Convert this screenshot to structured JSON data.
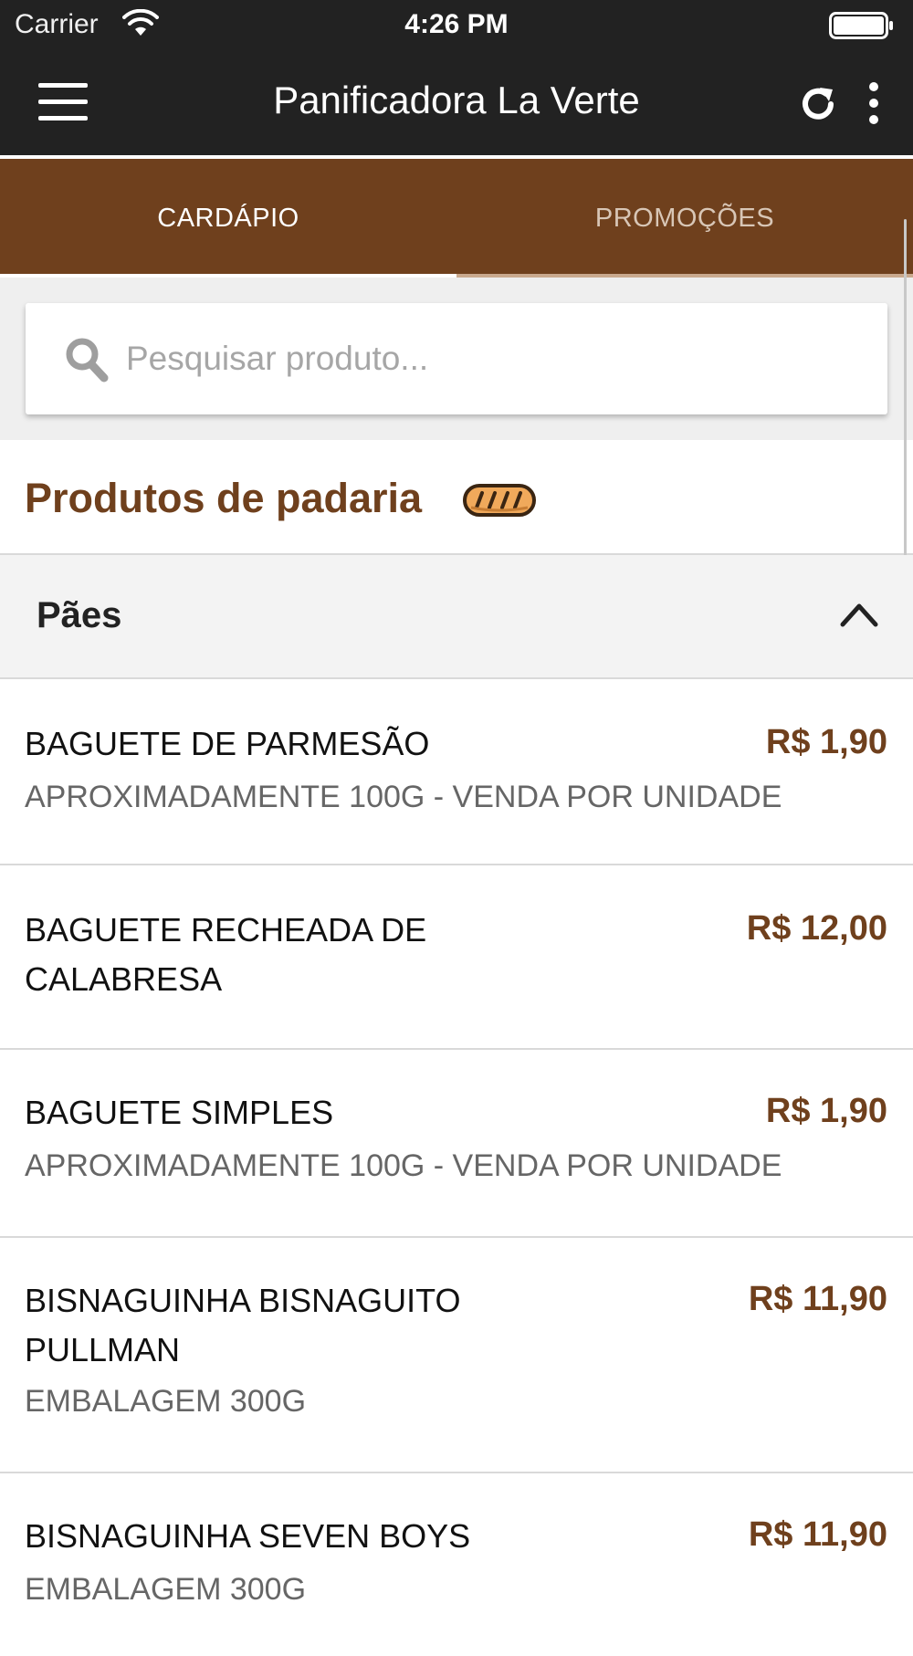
{
  "status_bar": {
    "carrier": "Carrier",
    "time": "4:26 PM"
  },
  "header": {
    "title": "Panificadora La Verte"
  },
  "tabs": [
    {
      "label": "CARDÁPIO",
      "active": true
    },
    {
      "label": "PROMOÇÕES",
      "active": false
    }
  ],
  "search": {
    "placeholder": "Pesquisar produto...",
    "value": ""
  },
  "section": {
    "title": "Produtos de padaria",
    "icon": "bread-icon"
  },
  "category": {
    "label": "Pães",
    "expanded": true
  },
  "products": [
    {
      "name": "BAGUETE DE PARMESÃO",
      "price": "R$ 1,90",
      "description": "APROXIMADAMENTE 100G - VENDA POR UNIDADE"
    },
    {
      "name": "BAGUETE RECHEADA DE CALABRESA",
      "price": "R$ 12,00",
      "description": ""
    },
    {
      "name": "BAGUETE SIMPLES",
      "price": "R$ 1,90",
      "description": "APROXIMADAMENTE 100G - VENDA POR UNIDADE"
    },
    {
      "name": "BISNAGUINHA BISNAGUITO PULLMAN",
      "price": "R$ 11,90",
      "description": "EMBALAGEM 300G"
    },
    {
      "name": "BISNAGUINHA SEVEN BOYS",
      "price": "R$ 11,90",
      "description": "EMBALAGEM 300G"
    }
  ],
  "colors": {
    "brand_brown": "#6f401d",
    "navbar": "#222222",
    "price": "#6f401d"
  }
}
